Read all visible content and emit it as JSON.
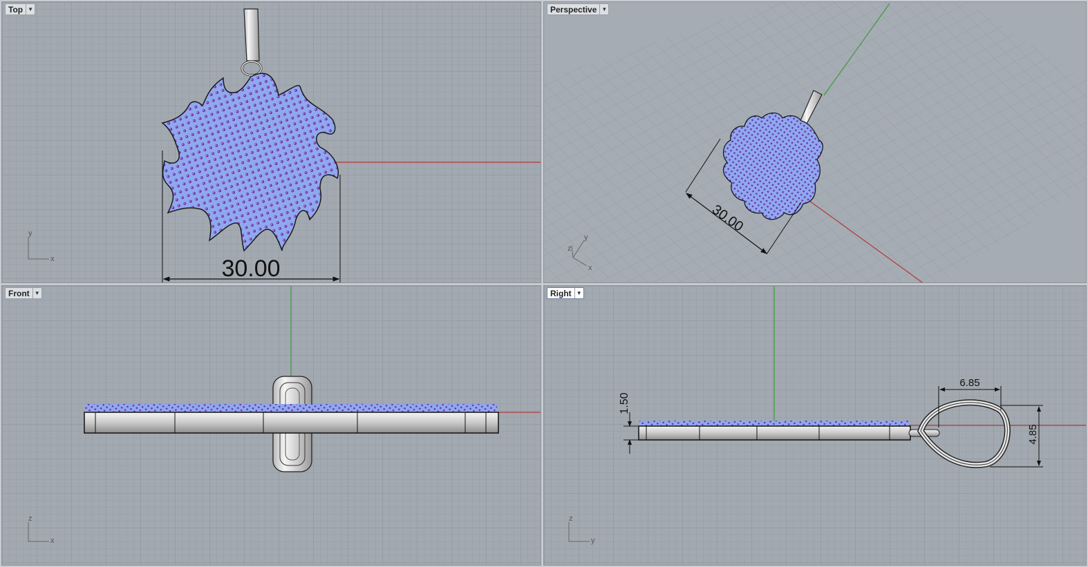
{
  "viewports": {
    "top": {
      "label": "Top",
      "axis_h": "x",
      "axis_v": "y",
      "dimension": "30.00"
    },
    "perspective": {
      "label": "Perspective",
      "axis_h": "x",
      "axis_v": "y",
      "axis_d": "z",
      "dimension": "30.00"
    },
    "front": {
      "label": "Front",
      "axis_h": "x",
      "axis_v": "z"
    },
    "right": {
      "label": "Right",
      "axis_h": "y",
      "axis_v": "z",
      "dim_thickness": "1.50",
      "dim_loop_width": "6.85",
      "dim_loop_height": "4.85"
    }
  },
  "colors": {
    "viewport_bg": "#a3a9b0",
    "grid_minor": "#979da4",
    "grid_major": "#8b9199",
    "x_axis": "#b03a3a",
    "y_axis": "#3a9a3a",
    "stone_fill": "#8fa8ee",
    "stone_dot": "#7a2aa0",
    "metal": "#d8d8d8"
  }
}
